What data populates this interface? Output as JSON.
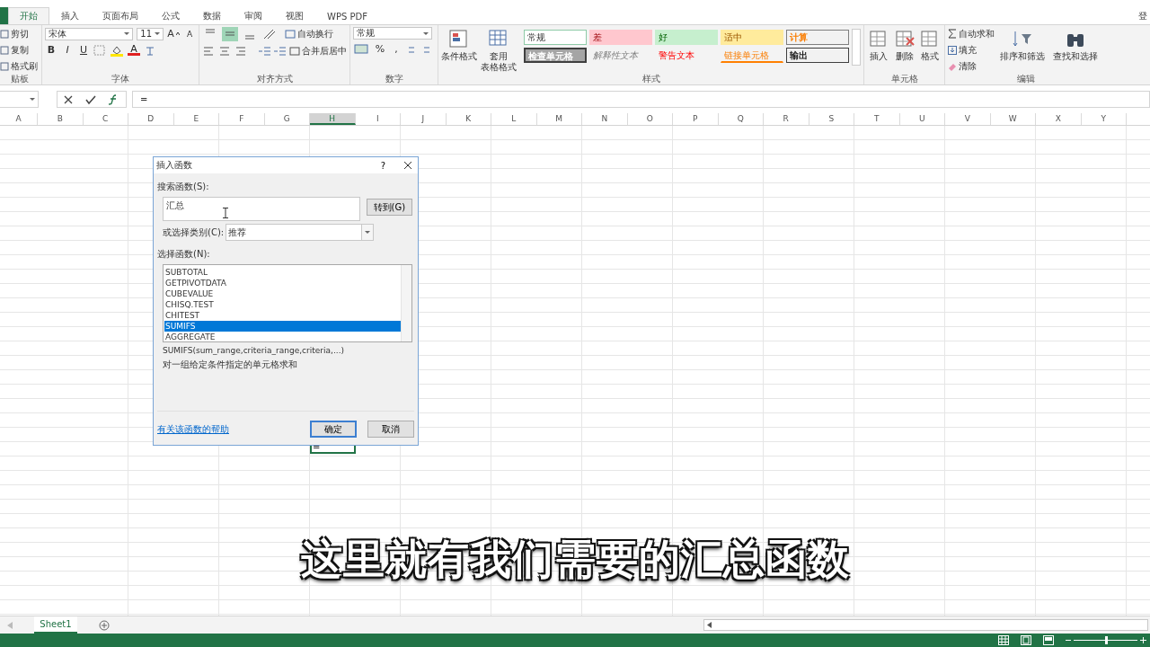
{
  "tabs": [
    {
      "label": "开始",
      "selected": true
    },
    {
      "label": "插入",
      "selected": false
    },
    {
      "label": "页面布局",
      "selected": false
    },
    {
      "label": "公式",
      "selected": false
    },
    {
      "label": "数据",
      "selected": false
    },
    {
      "label": "审阅",
      "selected": false
    },
    {
      "label": "视图",
      "selected": false
    },
    {
      "label": "WPS PDF",
      "selected": false
    }
  ],
  "account": "登",
  "ribbon": {
    "clipboard": {
      "items": [
        "剪切",
        "复制",
        "格式刷"
      ],
      "label": "贴板"
    },
    "font": {
      "name": "宋体",
      "size": "11",
      "grow": "A",
      "shrink": "A",
      "styles": [
        "B",
        "I",
        "U"
      ],
      "color_letter": "A",
      "label": "字体"
    },
    "alignment": {
      "vertical": [
        {
          "selected": false
        },
        {
          "selected": true
        },
        {
          "selected": false
        }
      ],
      "wrap": "自动换行",
      "merge": "合并后居中",
      "label": "对齐方式"
    },
    "number": {
      "format": "常规",
      "percent": "%",
      "comma": ",",
      "label": "数字"
    },
    "styles": {
      "conditional": "条件格式",
      "table_format": [
        "套用",
        "表格格式"
      ],
      "cells": [
        {
          "label": "常规",
          "kind": "normal"
        },
        {
          "label": "差",
          "kind": "bad"
        },
        {
          "label": "好",
          "kind": "good"
        },
        {
          "label": "适中",
          "kind": "neutral"
        },
        {
          "label": "计算",
          "kind": "calc"
        },
        {
          "label": "检查单元格",
          "kind": "check"
        },
        {
          "label": "解释性文本",
          "kind": "explain"
        },
        {
          "label": "警告文本",
          "kind": "warn"
        },
        {
          "label": "链接单元格",
          "kind": "link"
        },
        {
          "label": "输出",
          "kind": "output"
        }
      ],
      "label": "样式"
    },
    "cells": {
      "buttons": [
        "插入",
        "删除",
        "格式"
      ],
      "label": "单元格"
    },
    "editing": {
      "autosum": "自动求和",
      "fill": "填充",
      "clear": "清除",
      "sort": "排序和筛选",
      "find": "查找和选择",
      "label": "编辑"
    }
  },
  "formula_bar": {
    "formula": "="
  },
  "columns": [
    {
      "label": "A",
      "selected": false
    },
    {
      "label": "B",
      "selected": false
    },
    {
      "label": "C",
      "selected": false
    },
    {
      "label": "D",
      "selected": false
    },
    {
      "label": "E",
      "selected": false
    },
    {
      "label": "F",
      "selected": false
    },
    {
      "label": "G",
      "selected": false
    },
    {
      "label": "H",
      "selected": true
    },
    {
      "label": "I",
      "selected": false
    },
    {
      "label": "J",
      "selected": false
    },
    {
      "label": "K",
      "selected": false
    },
    {
      "label": "L",
      "selected": false
    },
    {
      "label": "M",
      "selected": false
    },
    {
      "label": "N",
      "selected": false
    },
    {
      "label": "O",
      "selected": false
    },
    {
      "label": "P",
      "selected": false
    },
    {
      "label": "Q",
      "selected": false
    },
    {
      "label": "R",
      "selected": false
    },
    {
      "label": "S",
      "selected": false
    },
    {
      "label": "T",
      "selected": false
    },
    {
      "label": "U",
      "selected": false
    },
    {
      "label": "V",
      "selected": false
    },
    {
      "label": "W",
      "selected": false
    },
    {
      "label": "X",
      "selected": false
    },
    {
      "label": "Y",
      "selected": false
    }
  ],
  "active_cell": {
    "value": "="
  },
  "dialog": {
    "title": "插入函数",
    "help": "?",
    "search_label": "搜索函数(S):",
    "search_value": "汇总",
    "go_button": "转到(G)",
    "category_label": "或选择类别(C):",
    "category_value": "推荐",
    "list_label": "选择函数(N):",
    "functions": [
      {
        "name": "SUBTOTAL",
        "selected": false
      },
      {
        "name": "GETPIVOTDATA",
        "selected": false
      },
      {
        "name": "CUBEVALUE",
        "selected": false
      },
      {
        "name": "CHISQ.TEST",
        "selected": false
      },
      {
        "name": "CHITEST",
        "selected": false
      },
      {
        "name": "SUMIFS",
        "selected": true
      },
      {
        "name": "AGGREGATE",
        "selected": false
      }
    ],
    "signature": "SUMIFS(sum_range,criteria_range,criteria,...)",
    "description": "对一组给定条件指定的单元格求和",
    "help_link": "有关该函数的帮助",
    "ok": "确定",
    "cancel": "取消"
  },
  "caption": "这里就有我们需要的汇总函数",
  "sheet_tabs": [
    {
      "label": "Sheet1",
      "selected": true
    }
  ],
  "zoom": {
    "level": 0.5
  }
}
